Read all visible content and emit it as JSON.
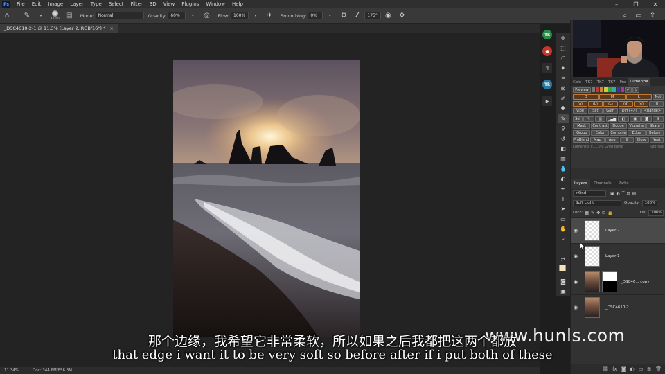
{
  "menubar": {
    "items": [
      "File",
      "Edit",
      "Image",
      "Layer",
      "Type",
      "Select",
      "Filter",
      "3D",
      "View",
      "Plugins",
      "Window",
      "Help"
    ]
  },
  "options": {
    "brush_size": "1100",
    "mode_label": "Mode:",
    "mode_value": "Normal",
    "opacity_label": "Opacity:",
    "opacity_value": "60%",
    "flow_label": "Flow:",
    "flow_value": "100%",
    "smoothing_label": "Smoothing:",
    "smoothing_value": "0%",
    "angle_value": "175°"
  },
  "document": {
    "tab_title": "_DSC4610-2-1 @ 11.3% (Layer 2, RGB/16*) *",
    "close_glyph": "×"
  },
  "status": {
    "zoom": "11.34%",
    "doc_size": "Doc: 344.6M/856.3M"
  },
  "lumenzia": {
    "tabs": [
      "Colo",
      "TK7",
      "TK7",
      "TK7",
      "Pro",
      "Lumenzia"
    ],
    "active_tab": "Lumenzia",
    "preview_label": "Preview",
    "row_dml": [
      "D",
      "M",
      "L",
      "Not"
    ],
    "row_abc": [
      "(a)",
      "(b)",
      "(c)",
      "(d)",
      "(e)",
      "(f)"
    ],
    "row_vibe": [
      "Vibe",
      "Sat",
      "Gam",
      "Diff (+/-)",
      "<Range>"
    ],
    "row_sel": [
      "Sel"
    ],
    "row_mask": [
      "Mask",
      "Contrast",
      "Dodge",
      "Vignette",
      "Sharp"
    ],
    "row_group": [
      "Group",
      "Color",
      "Combine",
      "Edge",
      "Before"
    ],
    "row_pre": [
      "ProBlend",
      "Map",
      "Ang",
      "If",
      "Close",
      "Next"
    ],
    "footer_left": "Lumenzia v11.0.0 Greg Benz",
    "footer_right": "Tutorials"
  },
  "layers_panel": {
    "tabs": [
      "Layers",
      "Channels",
      "Paths"
    ],
    "active_tab": "Layers",
    "filter_kind": "Kind",
    "blend_mode": "Soft Light",
    "opacity_label": "Opacity:",
    "opacity_value": "100%",
    "lock_label": "Lock:",
    "fill_label": "Fill:",
    "fill_value": "100%",
    "layers": [
      {
        "name": "Layer 2",
        "selected": true
      },
      {
        "name": "Layer 1",
        "selected": false
      },
      {
        "name": "_DSC46... copy",
        "selected": false
      },
      {
        "name": "_DSC4610-2",
        "selected": false
      }
    ]
  },
  "subtitles": {
    "zh": "那个边缘，我希望它非常柔软，所以如果之后我都把这两个都放",
    "en": "that edge i want it to be very soft so before after if i put both of these"
  },
  "watermark": "www.hunls.com",
  "colors": {
    "accent_orange": "#c37a30",
    "selection": "#4a4a4a",
    "foreground_swatch": "#f2e3c0",
    "background_swatch": "#d8e9c8"
  }
}
